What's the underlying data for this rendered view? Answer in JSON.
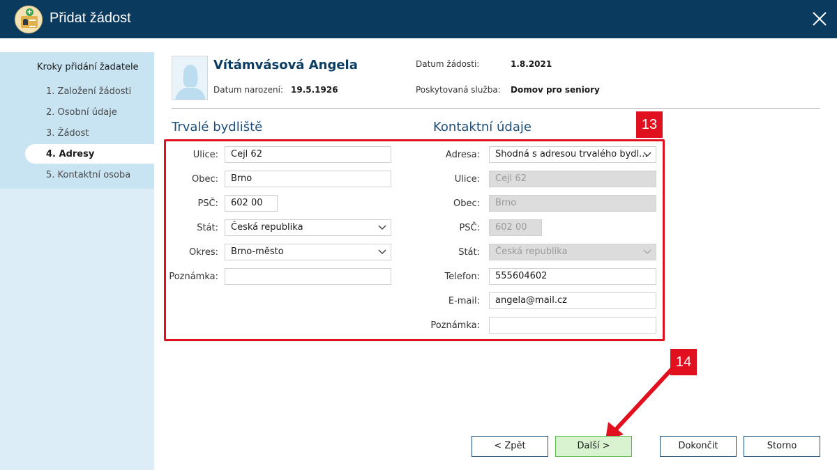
{
  "window": {
    "title": "Přidat žádost"
  },
  "sidebar": {
    "heading": "Kroky přidání žadatele",
    "steps": [
      {
        "label": "1. Založení žádosti"
      },
      {
        "label": "2. Osobní údaje"
      },
      {
        "label": "3. Žádost"
      },
      {
        "label": "4. Adresy"
      },
      {
        "label": "5. Kontaktní osoba"
      }
    ],
    "active_step": "4. Adresy"
  },
  "applicant": {
    "name": "Vítámvásová Angela",
    "birth_label": "Datum narození:",
    "birth_value": "19.5.1926",
    "request_date_label": "Datum žádosti:",
    "request_date_value": "1.8.2021",
    "service_label": "Poskytovaná služba:",
    "service_value": "Domov pro seniory"
  },
  "permanent_address": {
    "title": "Trvalé bydliště",
    "street_label": "Ulice:",
    "street_value": "Cejl 62",
    "city_label": "Obec:",
    "city_value": "Brno",
    "zip_label": "PSČ:",
    "zip_value": "602 00",
    "country_label": "Stát:",
    "country_value": "Česká republika",
    "district_label": "Okres:",
    "district_value": "Brno-město",
    "note_label": "Poznámka:",
    "note_value": ""
  },
  "contact": {
    "title": "Kontaktní údaje",
    "address_label": "Adresa:",
    "address_value": "Shodná s adresou trvalého bydl...",
    "street_label": "Ulice:",
    "street_value": "Cejl 62",
    "city_label": "Obec:",
    "city_value": "Brno",
    "zip_label": "PSČ:",
    "zip_value": "602 00",
    "country_label": "Stát:",
    "country_value": "Česká republika",
    "phone_label": "Telefon:",
    "phone_value": "555604602",
    "email_label": "E-mail:",
    "email_value": "angela@mail.cz",
    "note_label": "Poznámka:",
    "note_value": ""
  },
  "annotations": {
    "badge_13": "13",
    "badge_14": "14",
    "highlight_color": "#e0101e"
  },
  "buttons": {
    "back": "< Zpět",
    "next": "Další >",
    "finish": "Dokončit",
    "cancel": "Storno"
  },
  "colors": {
    "titlebar": "#0a3a5e",
    "sidebar": "#c8e3f2",
    "accent": "#1e4e79",
    "next_button": "#d9f2d0"
  },
  "icons": {
    "app": "application-add-icon",
    "close": "close-icon",
    "avatar": "person-silhouette-icon",
    "dropdown": "chevron-down-icon"
  }
}
